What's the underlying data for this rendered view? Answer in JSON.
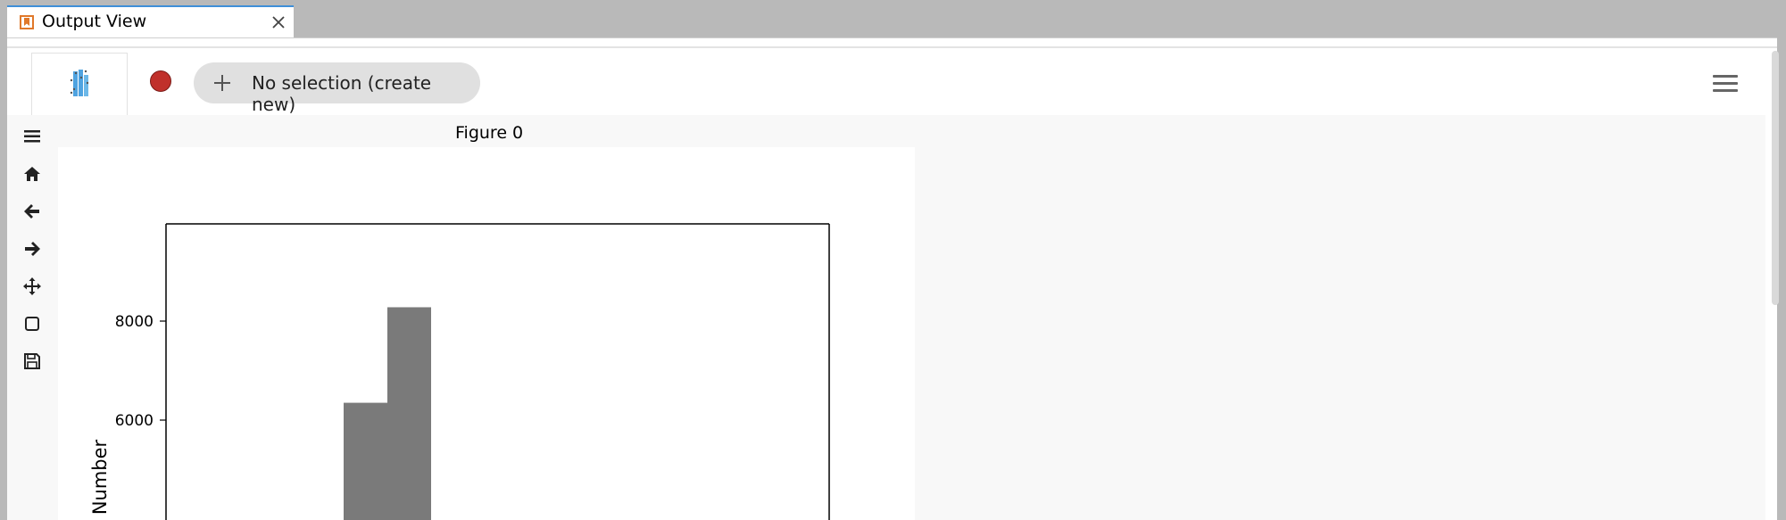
{
  "tab": {
    "title": "Output View",
    "icon": "bookmark-icon",
    "close_icon": "close-icon"
  },
  "toolbar": {
    "selection_label": "No selection (create new)",
    "record_color": "#c0302b",
    "menu_icon": "hamburger-icon"
  },
  "side_tools": [
    {
      "name": "menu-tool-icon"
    },
    {
      "name": "home-icon"
    },
    {
      "name": "back-icon"
    },
    {
      "name": "forward-icon"
    },
    {
      "name": "pan-icon"
    },
    {
      "name": "zoom-rect-icon"
    },
    {
      "name": "save-icon"
    }
  ],
  "figure": {
    "title": "Figure 0"
  },
  "chart_data": {
    "type": "bar",
    "title": "",
    "ylabel": "Number",
    "ylim": [
      3000,
      9800
    ],
    "yticks": [
      6000,
      8000
    ],
    "ytick_labels": [
      "6000",
      "8000"
    ],
    "values": [
      6350,
      8280
    ],
    "bar_color": "#7a7a7a",
    "grid": false
  }
}
